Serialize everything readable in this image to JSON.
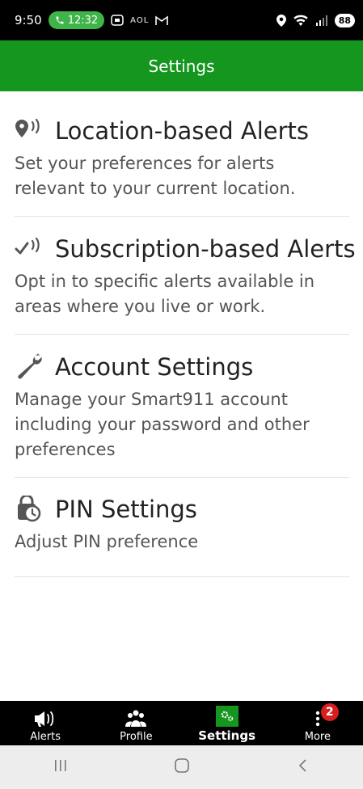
{
  "status_bar": {
    "time": "9:50",
    "call_timer": "12:32",
    "aol_label": "AOL",
    "battery": "88"
  },
  "header": {
    "title": "Settings"
  },
  "settings": [
    {
      "title": "Location-based Alerts",
      "description": "Set your preferences for alerts relevant to your current location.",
      "icon": "location-alert-icon"
    },
    {
      "title": "Subscription-based Alerts",
      "description": "Opt in to specific alerts available in areas where you live or work.",
      "icon": "subscription-alert-icon"
    },
    {
      "title": "Account Settings",
      "description": "Manage your Smart911 account including your password and other preferences",
      "icon": "wrench-icon"
    },
    {
      "title": "PIN Settings",
      "description": "Adjust PIN preference",
      "icon": "lock-clock-icon"
    }
  ],
  "bottom_nav": {
    "items": [
      {
        "label": "Alerts",
        "icon": "megaphone-icon"
      },
      {
        "label": "Profile",
        "icon": "people-icon"
      },
      {
        "label": "Settings",
        "icon": "gears-icon",
        "active": true
      },
      {
        "label": "More",
        "icon": "more-vertical-icon",
        "badge": "2"
      }
    ]
  },
  "colors": {
    "brand_green": "#15961f",
    "badge_red": "#d81e1e"
  }
}
